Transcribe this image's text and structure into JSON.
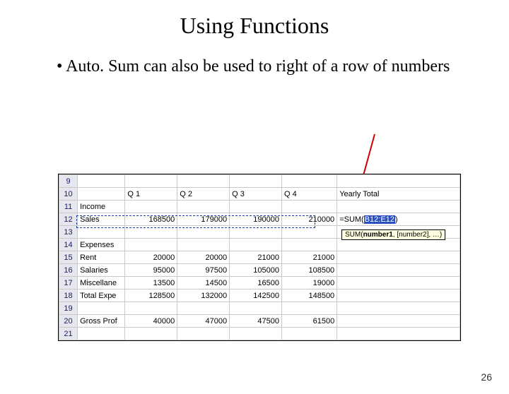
{
  "title": "Using Functions",
  "bullet": "Auto. Sum can also be used to right of a row of numbers",
  "page_number": "26",
  "sheet": {
    "row_numbers": [
      "9",
      "10",
      "11",
      "12",
      "13",
      "14",
      "15",
      "16",
      "17",
      "18",
      "19",
      "20",
      "21"
    ],
    "headers": {
      "q1": "Q 1",
      "q2": "Q 2",
      "q3": "Q 3",
      "q4": "Q 4",
      "yearly": "Yearly Total"
    },
    "labels": {
      "income": "Income",
      "sales": "Sales",
      "expenses": "Expenses",
      "rent": "Rent",
      "salaries": "Salaries",
      "misc": "Miscellane",
      "total_exp": "Total Expe",
      "gross": "Gross Prof"
    },
    "rows": {
      "sales": {
        "q1": "168500",
        "q2": "179000",
        "q3": "190000",
        "q4": "210000"
      },
      "rent": {
        "q1": "20000",
        "q2": "20000",
        "q3": "21000",
        "q4": "21000"
      },
      "salaries": {
        "q1": "95000",
        "q2": "97500",
        "q3": "105000",
        "q4": "108500"
      },
      "misc": {
        "q1": "13500",
        "q2": "14500",
        "q3": "16500",
        "q4": "19000"
      },
      "total_exp": {
        "q1": "128500",
        "q2": "132000",
        "q3": "142500",
        "q4": "148500"
      },
      "gross": {
        "q1": "40000",
        "q2": "47000",
        "q3": "47500",
        "q4": "61500"
      }
    },
    "formula": {
      "prefix": "=SUM(",
      "range": "B12:E12",
      "suffix": ")"
    },
    "tooltip": {
      "fn": "SUM(",
      "arg1": "number1",
      "rest": ", [number2], …)"
    }
  }
}
